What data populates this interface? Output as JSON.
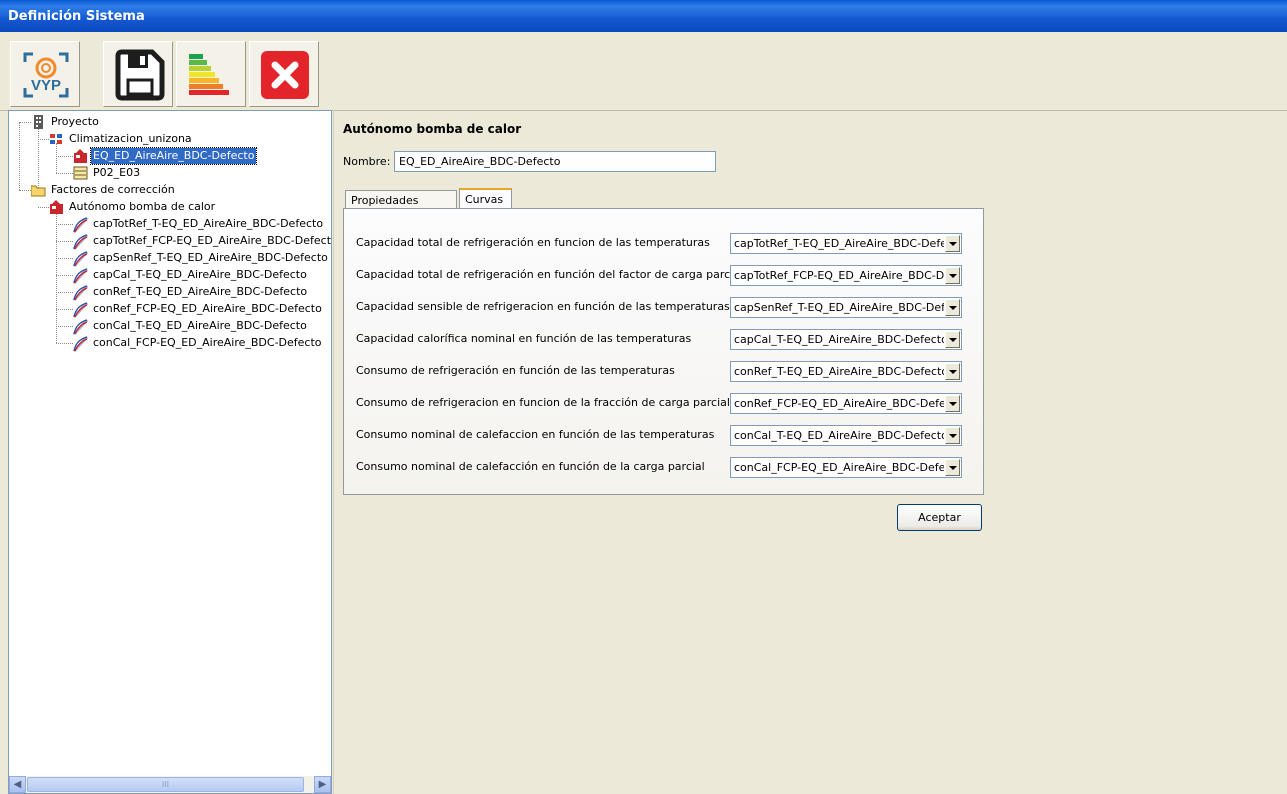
{
  "window": {
    "title": "Definición Sistema"
  },
  "toolbar": {
    "buttons": [
      {
        "name": "vyp-logo-button",
        "icon": "vyp-logo-icon",
        "logo_text": "VYP"
      },
      {
        "name": "save-button",
        "icon": "floppy-disk-icon"
      },
      {
        "name": "energy-rating-button",
        "icon": "energy-rating-bars-icon"
      },
      {
        "name": "close-button",
        "icon": "red-x-icon"
      }
    ]
  },
  "tree": {
    "nodes": [
      {
        "label": "Proyecto",
        "icon": "project-icon",
        "level": 0
      },
      {
        "label": "Climatizacion_unizona",
        "icon": "system-icon",
        "level": 1
      },
      {
        "label": "EQ_ED_AireAire_BDC-Defecto",
        "icon": "equipment-icon",
        "level": 2,
        "selected": true
      },
      {
        "label": "P02_E03",
        "icon": "unit-icon",
        "level": 2
      },
      {
        "label": "Factores de corrección",
        "icon": "folder-icon",
        "level": 0
      },
      {
        "label": "Autónomo bomba de calor",
        "icon": "equipment-icon",
        "level": 1
      },
      {
        "label": "capTotRef_T-EQ_ED_AireAire_BDC-Defecto",
        "icon": "curve-icon",
        "level": 2
      },
      {
        "label": "capTotRef_FCP-EQ_ED_AireAire_BDC-Defect",
        "icon": "curve-icon",
        "level": 2
      },
      {
        "label": "capSenRef_T-EQ_ED_AireAire_BDC-Defecto",
        "icon": "curve-icon",
        "level": 2
      },
      {
        "label": "capCal_T-EQ_ED_AireAire_BDC-Defecto",
        "icon": "curve-icon",
        "level": 2
      },
      {
        "label": "conRef_T-EQ_ED_AireAire_BDC-Defecto",
        "icon": "curve-icon",
        "level": 2
      },
      {
        "label": "conRef_FCP-EQ_ED_AireAire_BDC-Defecto",
        "icon": "curve-icon",
        "level": 2
      },
      {
        "label": "conCal_T-EQ_ED_AireAire_BDC-Defecto",
        "icon": "curve-icon",
        "level": 2
      },
      {
        "label": "conCal_FCP-EQ_ED_AireAire_BDC-Defecto",
        "icon": "curve-icon",
        "level": 2
      }
    ],
    "scroll_thumb_text": "III"
  },
  "panel": {
    "title": "Autónomo bomba de calor",
    "name_label": "Nombre:",
    "name_value": "EQ_ED_AireAire_BDC-Defecto",
    "tabs": [
      {
        "label": "Propiedades Basicas",
        "active": false
      },
      {
        "label": "Curvas",
        "active": true
      }
    ],
    "curves": [
      {
        "label": "Capacidad total de refrigeración en funcion de las temperaturas",
        "value": "capTotRef_T-EQ_ED_AireAire_BDC-Defecto"
      },
      {
        "label": "Capacidad total de refrigeración en función del  factor de carga parcial",
        "value": "capTotRef_FCP-EQ_ED_AireAire_BDC-Defecto"
      },
      {
        "label": "Capacidad sensible de refrigeracion en función de las temperaturas",
        "value": "capSenRef_T-EQ_ED_AireAire_BDC-Defecto"
      },
      {
        "label": "Capacidad calorífica nominal en función de las temperaturas",
        "value": "capCal_T-EQ_ED_AireAire_BDC-Defecto"
      },
      {
        "label": "Consumo de refrigeración en función de las temperaturas",
        "value": "conRef_T-EQ_ED_AireAire_BDC-Defecto"
      },
      {
        "label": "Consumo de refrigeracion en funcion de la fracción de carga parcial",
        "value": "conRef_FCP-EQ_ED_AireAire_BDC-Defecto"
      },
      {
        "label": "Consumo nominal de calefaccion en función de las temperaturas",
        "value": "conCal_T-EQ_ED_AireAire_BDC-Defecto"
      },
      {
        "label": "Consumo nominal de calefacción en función de la carga parcial",
        "value": "conCal_FCP-EQ_ED_AireAire_BDC-Defecto"
      }
    ],
    "accept_label": "Aceptar"
  }
}
